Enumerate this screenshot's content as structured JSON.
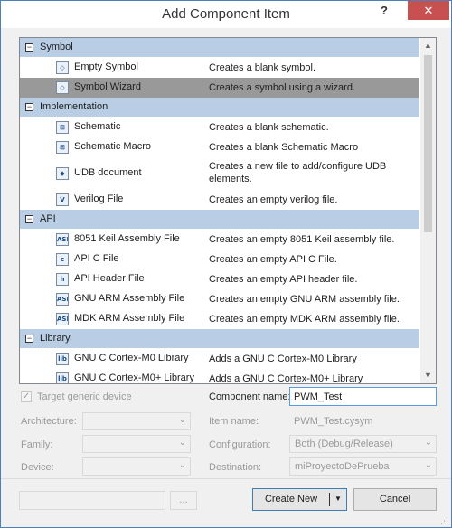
{
  "window": {
    "title": "Add Component Item",
    "help_glyph": "?",
    "close_glyph": "✕"
  },
  "groups": [
    {
      "title": "Symbol",
      "items": [
        {
          "name": "Empty Symbol",
          "desc": "Creates a blank symbol.",
          "icon": "symbol-icon",
          "glyph": "◇"
        },
        {
          "name": "Symbol Wizard",
          "desc": "Creates a symbol using a wizard.",
          "icon": "symbol-wizard-icon",
          "glyph": "◇",
          "selected": true
        }
      ]
    },
    {
      "title": "Implementation",
      "items": [
        {
          "name": "Schematic",
          "desc": "Creates a blank schematic.",
          "icon": "schematic-icon",
          "glyph": "⊞"
        },
        {
          "name": "Schematic Macro",
          "desc": "Creates a blank Schematic Macro",
          "icon": "schematic-macro-icon",
          "glyph": "⊞"
        },
        {
          "name": "UDB document",
          "desc": "Creates a new file to add/configure UDB elements.",
          "icon": "udb-document-icon",
          "glyph": "⬥",
          "tall": true
        },
        {
          "name": "Verilog File",
          "desc": "Creates an empty verilog file.",
          "icon": "verilog-file-icon",
          "glyph": "V"
        }
      ]
    },
    {
      "title": "API",
      "items": [
        {
          "name": "8051 Keil Assembly File",
          "desc": "Creates an empty 8051 Keil assembly file.",
          "icon": "asm-file-icon",
          "glyph": "ASM"
        },
        {
          "name": "API C File",
          "desc": "Creates an empty API C File.",
          "icon": "c-file-icon",
          "glyph": "c"
        },
        {
          "name": "API Header File",
          "desc": "Creates an empty API header file.",
          "icon": "h-file-icon",
          "glyph": "h"
        },
        {
          "name": "GNU ARM Assembly File",
          "desc": "Creates an empty GNU ARM assembly file.",
          "icon": "asm-file-icon",
          "glyph": "ASM"
        },
        {
          "name": "MDK ARM Assembly File",
          "desc": "Creates an empty MDK ARM assembly file.",
          "icon": "asm-file-icon",
          "glyph": "ASM"
        }
      ]
    },
    {
      "title": "Library",
      "items": [
        {
          "name": "GNU C Cortex-M0 Library",
          "desc": "Adds a GNU C Cortex-M0 Library",
          "icon": "lib-file-icon",
          "glyph": "lib"
        },
        {
          "name": "GNU C Cortex-M0+ Library",
          "desc": "Adds a GNU C Cortex-M0+ Library",
          "icon": "lib-file-icon",
          "glyph": "lib"
        }
      ]
    }
  ],
  "form": {
    "target_generic_label": "Target generic device",
    "target_generic_checked": true,
    "architecture_label": "Architecture:",
    "family_label": "Family:",
    "device_label": "Device:",
    "component_name_label": "Component name:",
    "component_name_value": "PWM_Test",
    "item_name_label": "Item name:",
    "item_name_value": "PWM_Test.cysym",
    "configuration_label": "Configuration:",
    "configuration_value": "Both (Debug/Release)",
    "destination_label": "Destination:",
    "destination_value": "miProyectoDePrueba"
  },
  "footer": {
    "browse_label": "...",
    "create_new_label": "Create New",
    "cancel_label": "Cancel"
  }
}
